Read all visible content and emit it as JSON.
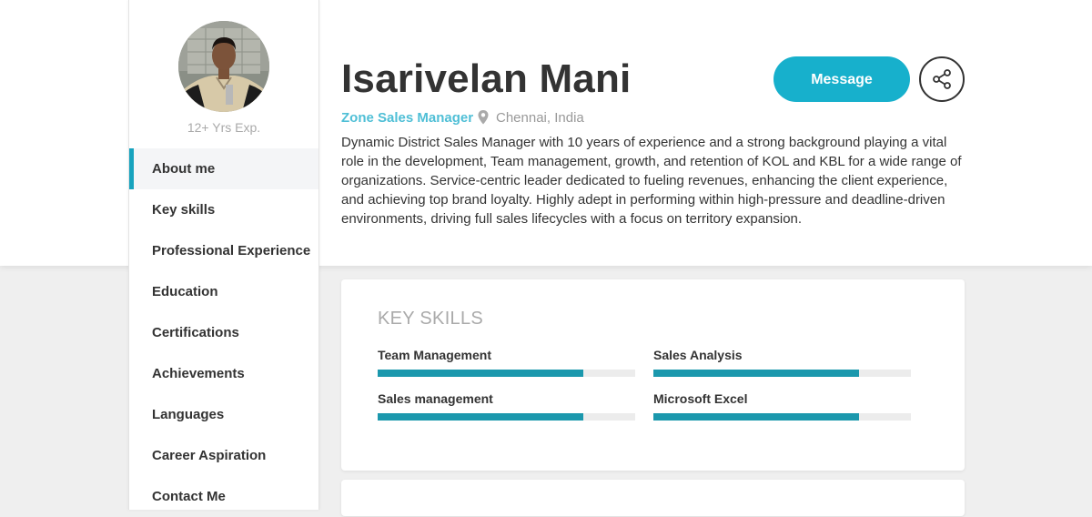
{
  "profile": {
    "name": "Isarivelan Mani",
    "role": "Zone Sales Manager",
    "location": "Chennai, India",
    "experience": "12+ Yrs Exp.",
    "about": "Dynamic District Sales Manager with 10 years of experience and a strong background playing a vital role in the development, Team management, growth, and retention of KOL and KBL for a wide range of organizations. Service-centric leader dedicated to fueling revenues, enhancing the client experience, and achieving top brand loyalty. Highly adept in performing within high-pressure and deadline-driven environments, driving full sales lifecycles with a focus on territory expansion."
  },
  "actions": {
    "message_label": "Message",
    "share_icon": "share-icon"
  },
  "sidebar": {
    "items": [
      {
        "label": "About me",
        "active": true
      },
      {
        "label": "Key skills",
        "active": false
      },
      {
        "label": "Professional Experience",
        "active": false
      },
      {
        "label": "Education",
        "active": false
      },
      {
        "label": "Certifications",
        "active": false
      },
      {
        "label": "Achievements",
        "active": false
      },
      {
        "label": "Languages",
        "active": false
      },
      {
        "label": "Career Aspiration",
        "active": false
      },
      {
        "label": "Contact Me",
        "active": false
      }
    ]
  },
  "skills": {
    "title": "KEY SKILLS",
    "items": [
      {
        "label": "Team Management",
        "level": 0.8
      },
      {
        "label": "Sales Analysis",
        "level": 0.8
      },
      {
        "label": "Sales management",
        "level": 0.8
      },
      {
        "label": "Microsoft Excel",
        "level": 0.8
      }
    ]
  },
  "colors": {
    "accent": "#17b0cc",
    "bar": "#1b98ad",
    "role": "#4fbfd6"
  }
}
